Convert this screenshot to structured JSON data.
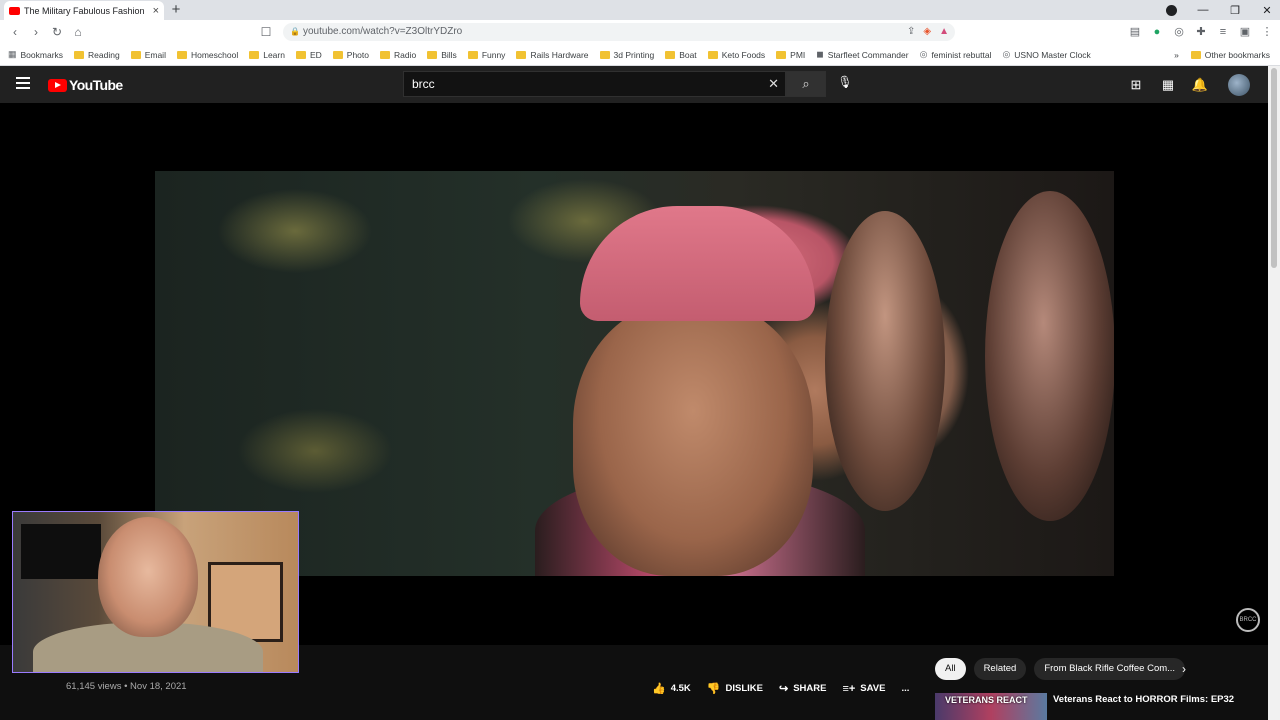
{
  "browser": {
    "tab_title": "The Military Fabulous Fashion",
    "new_tab_symbol": "+",
    "url": "youtube.com/watch?v=Z3OltrYDZro",
    "bookmarks": [
      "Bookmarks",
      "Reading",
      "Email",
      "Homeschool",
      "Learn",
      "ED",
      "Photo",
      "Radio",
      "Bills",
      "Funny",
      "Rails Hardware",
      "3d Printing",
      "Boat",
      "Keto Foods",
      "PMI"
    ],
    "bookmarks_special": [
      "Starfleet Commander",
      "feminist rebuttal",
      "USNO Master Clock"
    ],
    "bookmarks_overflow": "»",
    "other_bookmarks": "Other bookmarks"
  },
  "youtube": {
    "logo_text": "YouTube",
    "search_value": "brcc",
    "video": {
      "views_date": "61,145 views • Nov 18, 2021",
      "like_count": "4.5K",
      "dislike_label": "DISLIKE",
      "share_label": "SHARE",
      "save_label": "SAVE",
      "more_label": "..."
    },
    "chips": [
      "All",
      "Related",
      "From Black Rifle Coffee Com..."
    ],
    "recommendation": {
      "thumb_text": "VETERANS REACT",
      "title": "Veterans React to HORROR Films: EP32"
    }
  },
  "colors": {
    "youtube_red": "#ff0000",
    "header_bg": "#212121",
    "page_bg": "#0f0f0f",
    "webcam_border": "#9a7bff"
  },
  "icons": {
    "tab_close": "×",
    "back": "‹",
    "forward": "›",
    "reload": "↻",
    "home": "⌂",
    "search": "⌕",
    "clear": "✕",
    "mic": "🎙",
    "create": "⊞",
    "apps": "▦",
    "bell": "🔔",
    "like": "👍",
    "dislike": "👎",
    "share": "↪",
    "save": "≡+",
    "chevron_right": "›"
  }
}
